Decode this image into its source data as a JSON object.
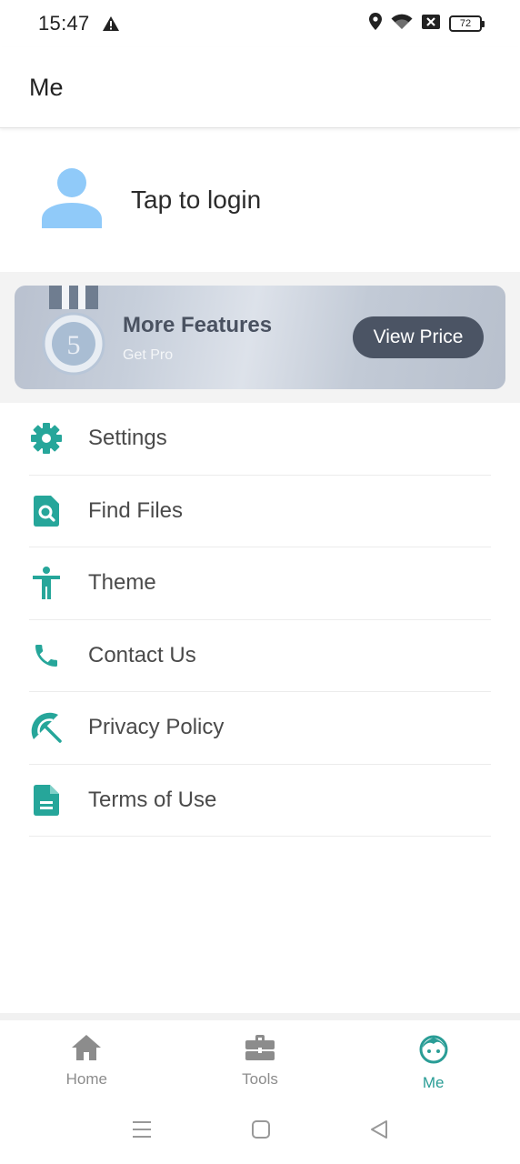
{
  "status_bar": {
    "time": "15:47",
    "battery": "72"
  },
  "app_bar": {
    "title": "Me"
  },
  "login": {
    "label": "Tap to login"
  },
  "promo": {
    "title": "More Features",
    "subtitle": "Get Pro",
    "button": "View Price",
    "medal_number": "5"
  },
  "menu": {
    "items": [
      {
        "label": "Settings",
        "icon": "gear-icon"
      },
      {
        "label": "Find Files",
        "icon": "file-search-icon"
      },
      {
        "label": "Theme",
        "icon": "accessibility-icon"
      },
      {
        "label": "Contact Us",
        "icon": "phone-icon"
      },
      {
        "label": "Privacy Policy",
        "icon": "umbrella-icon"
      },
      {
        "label": "Terms of Use",
        "icon": "document-icon"
      }
    ]
  },
  "bottom_nav": {
    "items": [
      {
        "label": "Home",
        "icon": "home-icon",
        "active": false
      },
      {
        "label": "Tools",
        "icon": "toolbox-icon",
        "active": false
      },
      {
        "label": "Me",
        "icon": "face-icon",
        "active": true
      }
    ]
  },
  "colors": {
    "accent": "#2a9d96",
    "promo_button": "#4b5464",
    "avatar": "#90caf9"
  }
}
